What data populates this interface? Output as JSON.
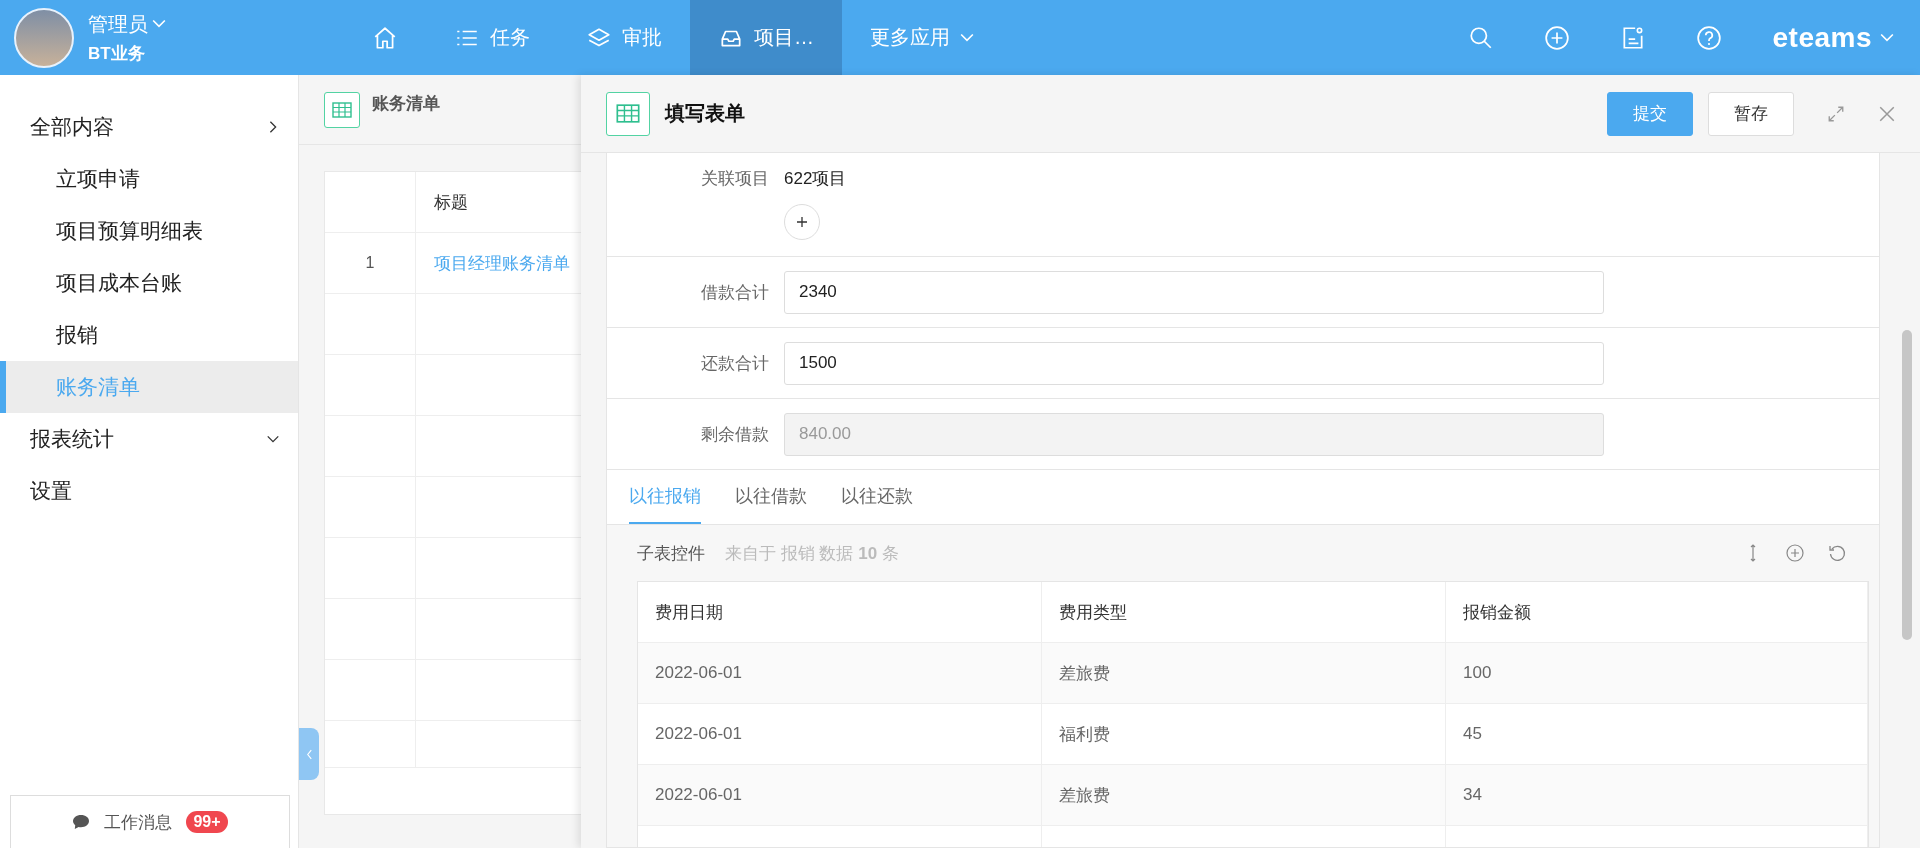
{
  "topbar": {
    "user": {
      "name": "管理员",
      "org": "BT业务"
    },
    "nav": [
      {
        "kind": "home",
        "selected": false
      },
      {
        "kind": "list",
        "label": "任务",
        "selected": false
      },
      {
        "kind": "layers",
        "label": "审批",
        "selected": false
      },
      {
        "kind": "inbox",
        "label": "项目…",
        "selected": true
      },
      {
        "kind": "more",
        "label": "更多应用",
        "selected": false
      }
    ],
    "brand": "eteams"
  },
  "sidebar": {
    "items": [
      {
        "label": "全部内容",
        "expanded": false,
        "selected": false,
        "children": [
          {
            "label": "立项申请",
            "selected": false
          },
          {
            "label": "项目预算明细表",
            "selected": false
          },
          {
            "label": "项目成本台账",
            "selected": false
          },
          {
            "label": "报销",
            "selected": false
          },
          {
            "label": "账务清单",
            "selected": true
          }
        ]
      },
      {
        "label": "报表统计",
        "expanded": true,
        "selected": false
      },
      {
        "label": "设置",
        "selected": false
      }
    ],
    "messages": {
      "label": "工作消息",
      "badge": "99+"
    }
  },
  "list": {
    "title": "账务清单",
    "columns": [
      "标题"
    ],
    "rows": [
      {
        "index": "1",
        "title": "项目经理账务清单"
      }
    ]
  },
  "drawer": {
    "title": "填写表单",
    "buttons": [
      {
        "label": "提交",
        "kind": "primary"
      },
      {
        "label": "暂存",
        "kind": "default"
      }
    ],
    "fields": [
      {
        "label": "关联项目",
        "kind": "link",
        "value": "622项目"
      },
      {
        "label": "借款合计",
        "kind": "input",
        "value": "2340"
      },
      {
        "label": "还款合计",
        "kind": "input",
        "value": "1500"
      },
      {
        "label": "剩余借款",
        "kind": "readonly",
        "value": "840.00"
      }
    ],
    "tabs": [
      {
        "label": "以往报销",
        "selected": true
      },
      {
        "label": "以往借款",
        "selected": false
      },
      {
        "label": "以往还款",
        "selected": false
      }
    ],
    "subtable": {
      "title": "子表控件",
      "source": "来自于 报销 数据 **10** 条",
      "columns": [
        "费用日期",
        "费用类型",
        "报销金额"
      ],
      "rows": [
        [
          "2022-06-01",
          "差旅费",
          "100"
        ],
        [
          "2022-06-01",
          "福利费",
          "45"
        ],
        [
          "2022-06-01",
          "差旅费",
          "34"
        ]
      ]
    }
  }
}
